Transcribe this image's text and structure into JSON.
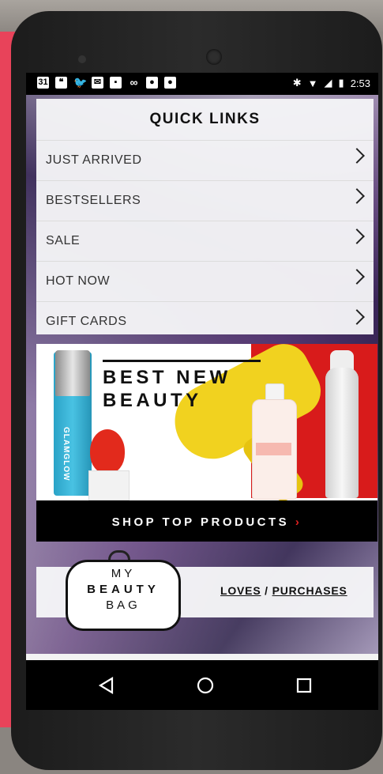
{
  "status_bar": {
    "left_icons": [
      "calendar-icon",
      "hangouts-icon",
      "twitter-icon",
      "mail-icon",
      "gallery-icon",
      "voicemail-icon",
      "shopping-bag-icon",
      "shopping-bag-icon"
    ],
    "calendar_day": "31",
    "time": "2:53"
  },
  "quick_links": {
    "title": "QUICK LINKS",
    "items": [
      {
        "label": "JUST ARRIVED"
      },
      {
        "label": "BESTSELLERS"
      },
      {
        "label": "SALE"
      },
      {
        "label": "HOT NOW"
      },
      {
        "label": "GIFT CARDS"
      }
    ]
  },
  "banner": {
    "headline_line1": "BEST NEW",
    "headline_line2": "BEAUTY",
    "product_text": "GLAMGLOW",
    "cta": "SHOP TOP PRODUCTS",
    "cta_arrow": "›",
    "accent_color": "#d81b1b"
  },
  "beauty_bag": {
    "line1": "MY",
    "line2": "BEAUTY",
    "line3": "BAG",
    "loves_label": "LOVES",
    "separator": "/",
    "purchases_label": "PURCHASES"
  },
  "nav_bar": {
    "buttons": [
      "back-icon",
      "home-icon",
      "recents-icon"
    ]
  }
}
